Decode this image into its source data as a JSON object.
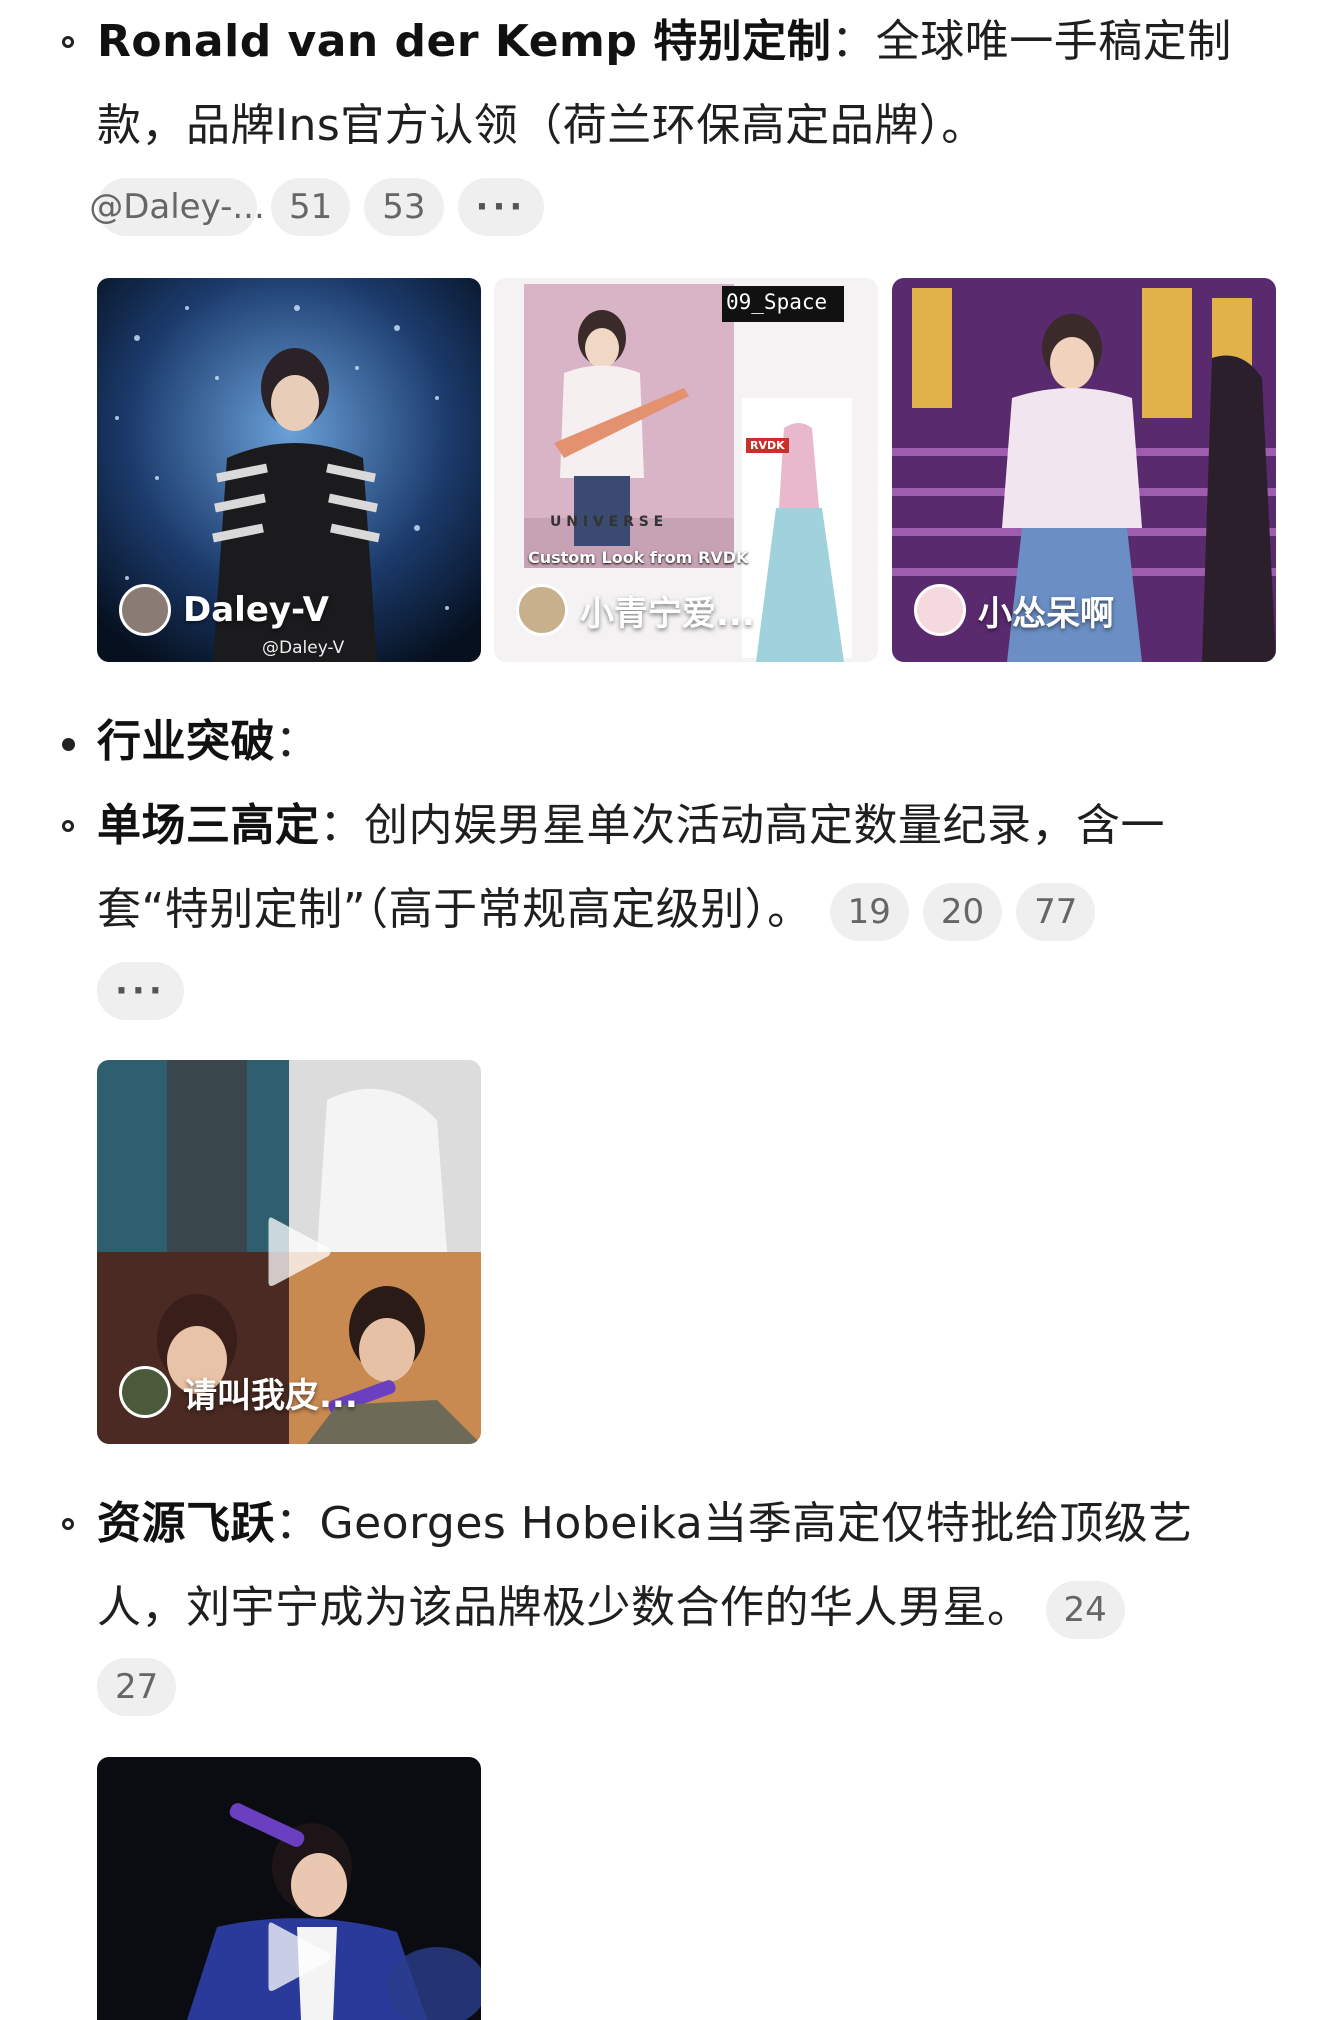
{
  "section1": {
    "bold": "Ronald van der Kemp 特别定制",
    "text": "：全球唯一手稿定制款，品牌Ins官方认领（荷兰环保高定品牌）。",
    "pills": [
      "@Daley-...",
      "51",
      "53",
      "···"
    ],
    "images": [
      {
        "user": "Daley-V",
        "watermark": "@Daley-V"
      },
      {
        "user": "小青宁爱...",
        "tag": "09_Space",
        "poster_word": "U N I V E R S E",
        "poster_caption": "Custom Look from RVDK",
        "sketch_label": "RVDK"
      },
      {
        "user": "小怂呆啊"
      }
    ]
  },
  "section2": {
    "bold": "行业突破",
    "text": "："
  },
  "section3": {
    "bold": "单场三高定",
    "text": "：创内娱男星单次活动高定数量纪录，含一套“特别定制”（高于常规高定级别）。",
    "pills": [
      "19",
      "20",
      "77"
    ],
    "more": "···",
    "video": {
      "user": "请叫我皮..."
    }
  },
  "section4": {
    "bold": "资源飞跃",
    "text": "：Georges Hobeika当季高定仅特批给顶级艺人，刘宇宁成为该品牌极少数合作的华人男星。",
    "pills": [
      "24"
    ],
    "pill_extra": "27"
  },
  "colors": {
    "pill_bg": "#efefef",
    "pill_text": "#666666",
    "text": "#1f1f1f"
  }
}
